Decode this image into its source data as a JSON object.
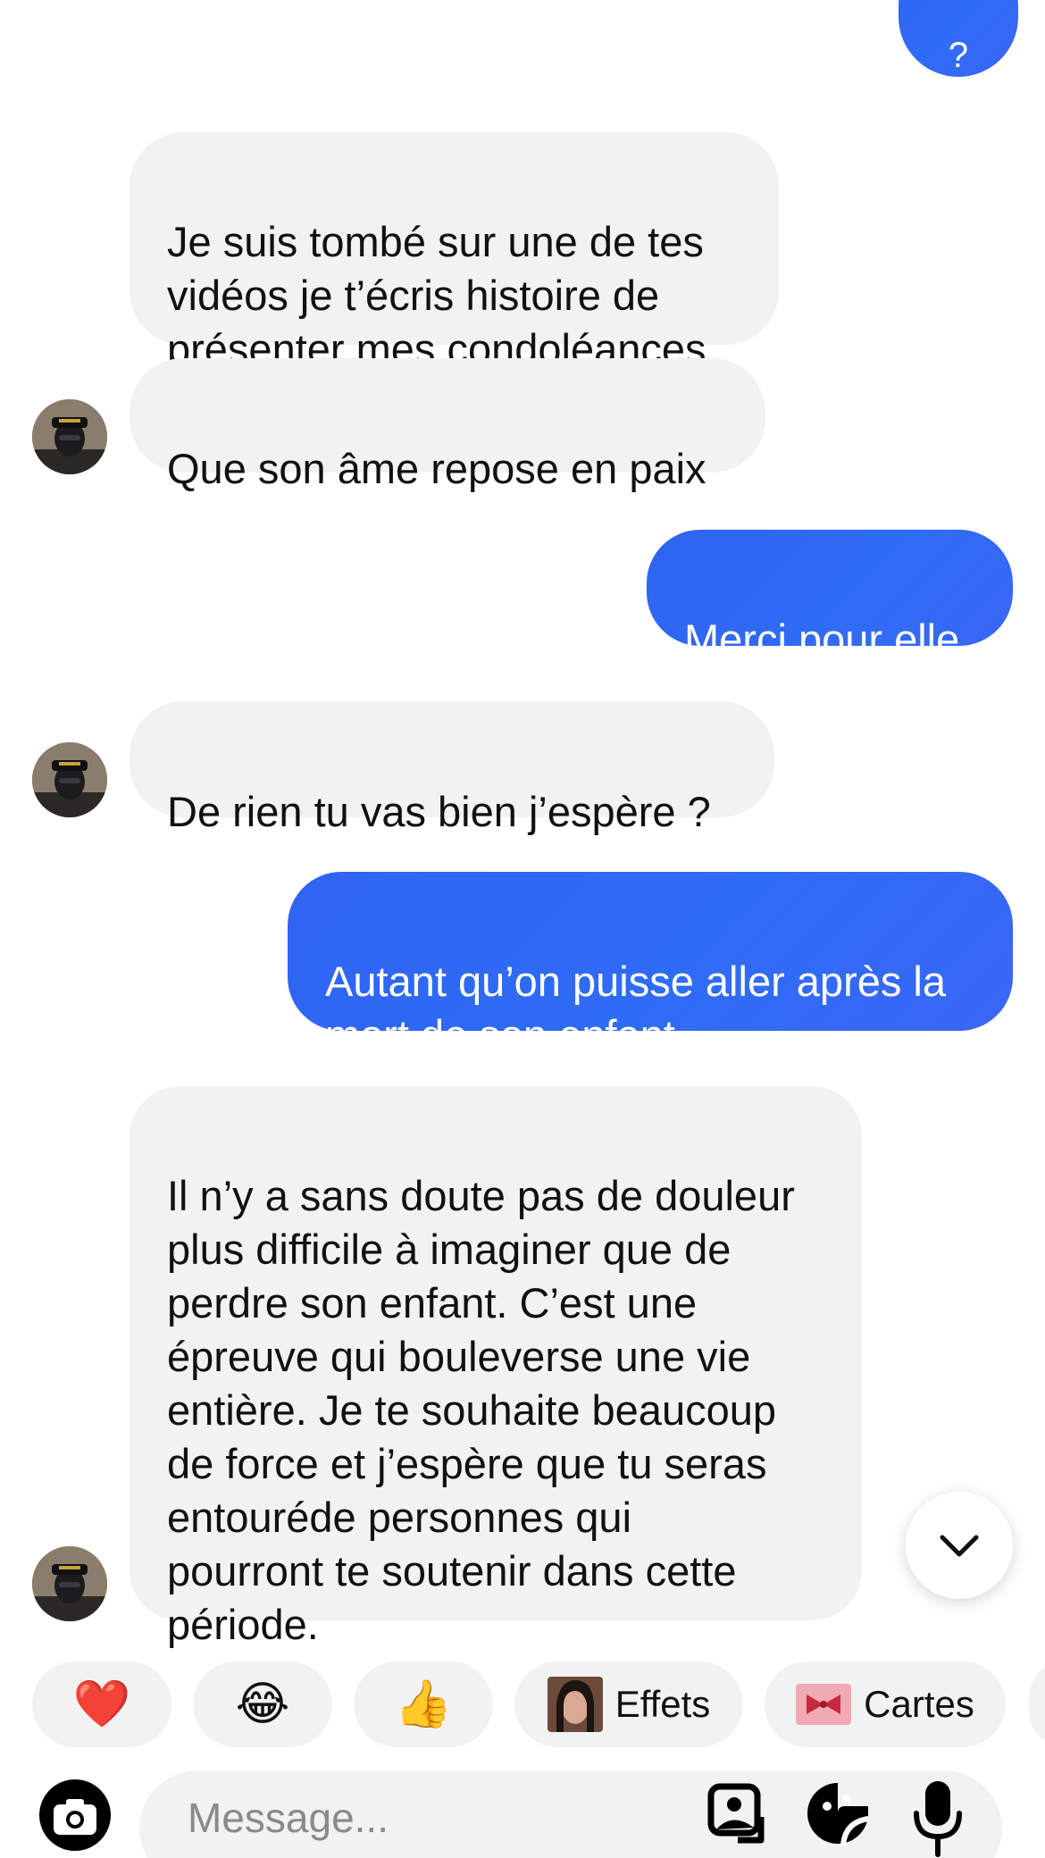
{
  "conversation": {
    "messages": [
      {
        "direction": "outgoing",
        "text": "?"
      },
      {
        "direction": "incoming",
        "text": "Je suis tombé sur une de tes\nvidéos je t’écris histoire de\nprésenter mes condoléances"
      },
      {
        "direction": "incoming",
        "text": "Que son âme repose en paix"
      },
      {
        "direction": "outgoing",
        "text": "Merci pour elle"
      },
      {
        "direction": "incoming",
        "text": "De rien tu vas bien j’espère ?"
      },
      {
        "direction": "outgoing",
        "text": "Autant qu’on puisse aller après la\nmort de son enfant"
      },
      {
        "direction": "incoming",
        "text": "Il n’y a sans doute pas de douleur\nplus difficile à imaginer que de\nperdre son enfant. C’est une\népreuve qui bouleverse une vie\nentière. Je te souhaite beaucoup\nde force et j’espère que tu seras\nentourédе personnes qui\npourront te soutenir dans cette\npériode."
      }
    ]
  },
  "quick_reactions": {
    "heart": "❤️",
    "laugh": "😂",
    "thumbs_up": "👍",
    "effects_label": "Effets",
    "cards_label": "Cartes"
  },
  "composer": {
    "placeholder": "Message..."
  },
  "colors": {
    "outgoing_bubble": "#2f66f5",
    "incoming_bubble": "#f2f2f2",
    "background": "#ffffff"
  },
  "icons": {
    "scroll_down": "chevron-down-icon",
    "camera": "camera-icon",
    "gallery": "gallery-icon",
    "sticker": "sticker-icon",
    "microphone": "microphone-icon"
  }
}
